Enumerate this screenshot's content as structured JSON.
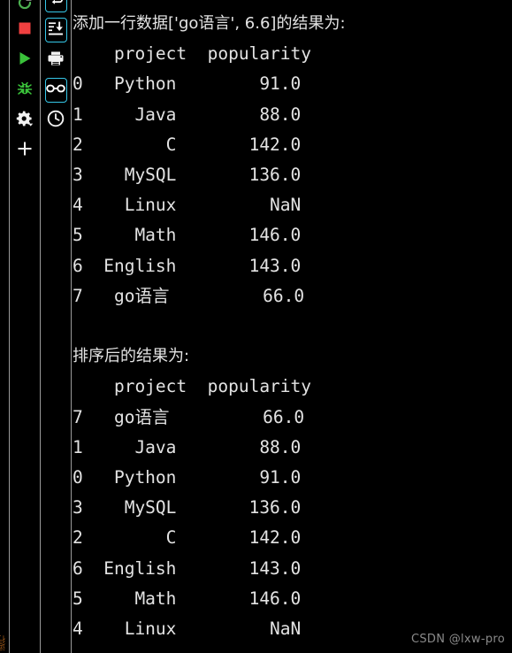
{
  "window": {
    "background_color": "#000000",
    "text_color": "#e3e3e3",
    "accent_color": "#35c7e8"
  },
  "gutter": {
    "vertical_tab_label": "运行"
  },
  "toolbar_primary": {
    "name": "run-toolbar",
    "buttons": [
      {
        "icon": "rerun-icon",
        "label": "Rerun",
        "color": "#4caf50",
        "state": "clipped"
      },
      {
        "icon": "stop-icon",
        "label": "Stop",
        "color": "#f04040",
        "state": "normal"
      },
      {
        "icon": "run-icon",
        "label": "Run",
        "color": "#3ac13a",
        "state": "normal"
      },
      {
        "icon": "debug-icon",
        "label": "Debug",
        "color": "#3ac13a",
        "state": "normal"
      },
      {
        "icon": "gear-dropdown-icon",
        "label": "Settings",
        "color": "#e3e3e3",
        "state": "normal"
      },
      {
        "icon": "plus-icon",
        "label": "Add",
        "color": "#e3e3e3",
        "state": "normal"
      }
    ]
  },
  "toolbar_secondary": {
    "name": "console-toolbar",
    "buttons": [
      {
        "icon": "soft-wrap-icon",
        "label": "Soft-Wrap",
        "color": "#ffffff",
        "state": "clipped-boxed"
      },
      {
        "icon": "scroll-to-end-icon",
        "label": "Scroll to End",
        "color": "#ffffff",
        "state": "boxed"
      },
      {
        "icon": "print-icon",
        "label": "Print",
        "color": "#ffffff",
        "state": "normal"
      },
      {
        "icon": "glasses-icon",
        "label": "Soft-Wrap Console",
        "color": "#ffffff",
        "state": "boxed"
      },
      {
        "icon": "clock-icon",
        "label": "History",
        "color": "#ffffff",
        "state": "normal"
      }
    ]
  },
  "console": {
    "lines": [
      {
        "type": "cjk",
        "text": "添加一行数据['go语言', 6.6]的结果为:"
      },
      {
        "type": "mono",
        "text": "    project  popularity"
      },
      {
        "type": "mono",
        "text": "0   Python        91.0"
      },
      {
        "type": "mono",
        "text": "1     Java        88.0"
      },
      {
        "type": "mono",
        "text": "2        C       142.0"
      },
      {
        "type": "mono",
        "text": "3    MySQL       136.0"
      },
      {
        "type": "mono",
        "text": "4    Linux         NaN"
      },
      {
        "type": "mono",
        "text": "5     Math       146.0"
      },
      {
        "type": "mono",
        "text": "6  English       143.0"
      },
      {
        "type": "mono",
        "text": "7   go语言         66.0"
      },
      {
        "type": "blank",
        "text": " "
      },
      {
        "type": "cjk",
        "text": "排序后的结果为:"
      },
      {
        "type": "mono",
        "text": "    project  popularity"
      },
      {
        "type": "mono",
        "text": "7   go语言         66.0"
      },
      {
        "type": "mono",
        "text": "1     Java        88.0"
      },
      {
        "type": "mono",
        "text": "0   Python        91.0"
      },
      {
        "type": "mono",
        "text": "3    MySQL       136.0"
      },
      {
        "type": "mono",
        "text": "2        C       142.0"
      },
      {
        "type": "mono",
        "text": "6  English       143.0"
      },
      {
        "type": "mono",
        "text": "5     Math       146.0"
      },
      {
        "type": "mono",
        "text": "4    Linux         NaN"
      }
    ],
    "tables": {
      "after_append": {
        "caption": "添加一行数据['go语言', 6.6]的结果为:",
        "columns": [
          "project",
          "popularity"
        ],
        "index": [
          "0",
          "1",
          "2",
          "3",
          "4",
          "5",
          "6",
          "7"
        ],
        "project": [
          "Python",
          "Java",
          "C",
          "MySQL",
          "Linux",
          "Math",
          "English",
          "go语言"
        ],
        "popularity": [
          "91.0",
          "88.0",
          "142.0",
          "136.0",
          "NaN",
          "146.0",
          "143.0",
          "66.0"
        ]
      },
      "after_sort": {
        "caption": "排序后的结果为:",
        "columns": [
          "project",
          "popularity"
        ],
        "index": [
          "7",
          "1",
          "0",
          "3",
          "2",
          "6",
          "5",
          "4"
        ],
        "project": [
          "go语言",
          "Java",
          "Python",
          "MySQL",
          "C",
          "English",
          "Math",
          "Linux"
        ],
        "popularity": [
          "66.0",
          "88.0",
          "91.0",
          "136.0",
          "142.0",
          "143.0",
          "146.0",
          "NaN"
        ]
      }
    }
  },
  "watermark": {
    "text": "CSDN @lxw-pro"
  }
}
